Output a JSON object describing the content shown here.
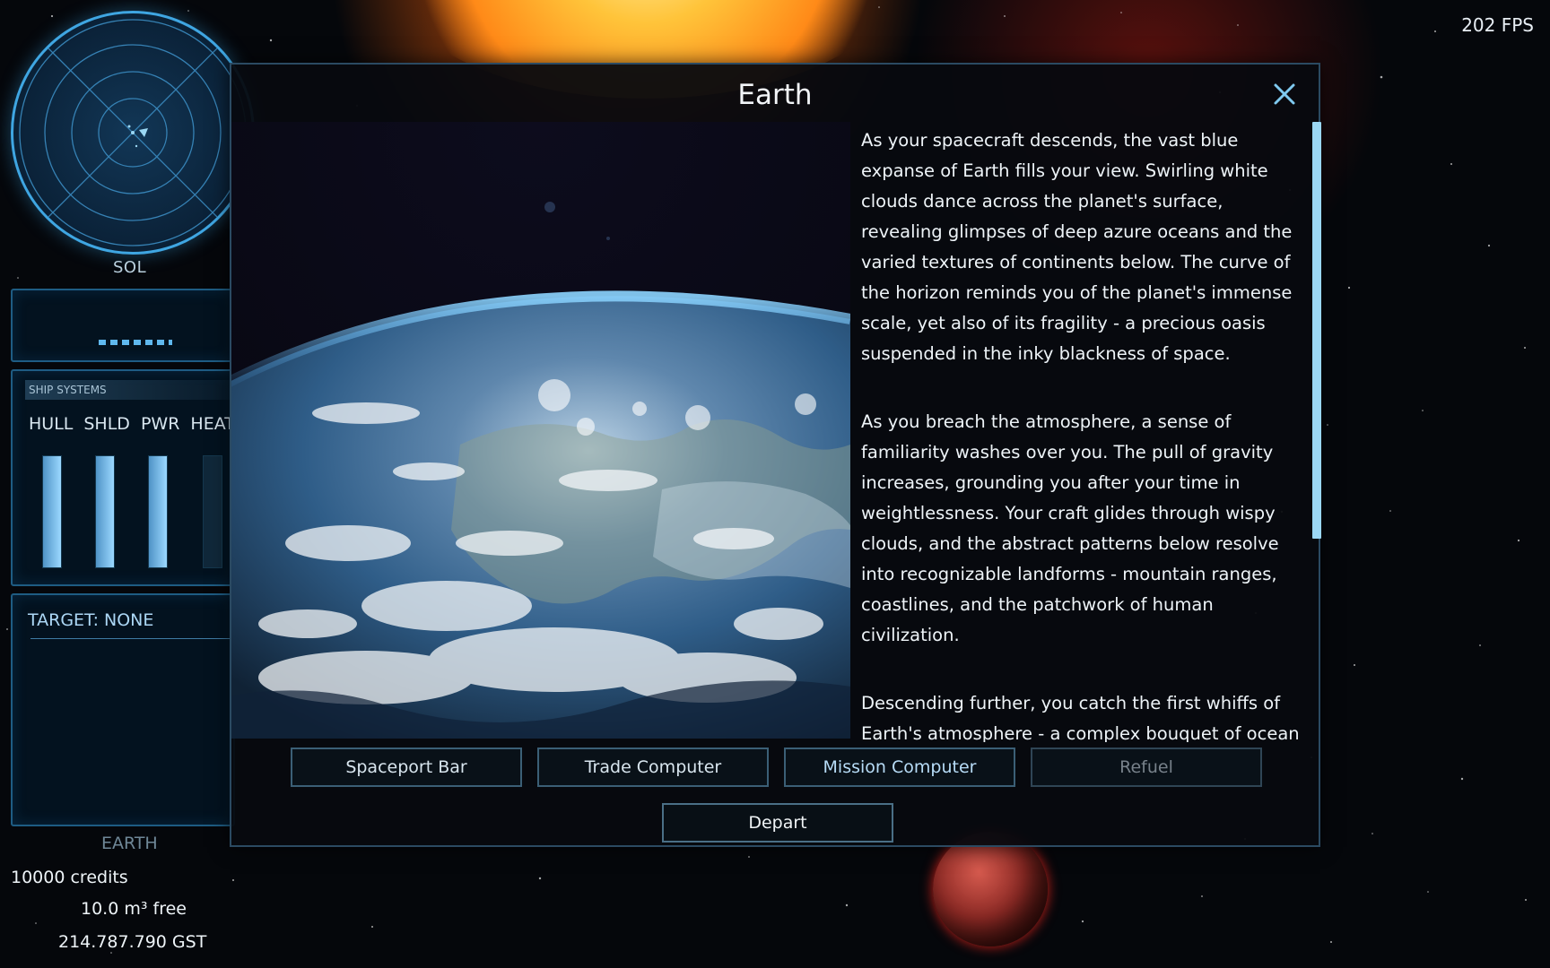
{
  "hud": {
    "fps": "202 FPS",
    "system_name": "SOL",
    "systems_panel": {
      "title": "SHIP SYSTEMS",
      "labels": [
        "HULL",
        "SHLD",
        "PWR",
        "HEAT"
      ],
      "levels": [
        1.0,
        1.0,
        1.0,
        0.0
      ]
    },
    "target_label": "TARGET: NONE",
    "location": "EARTH",
    "credits": "10000 credits",
    "cargo_free": "10.0 m³ free",
    "date": "214.787.790 GST"
  },
  "dialog": {
    "title": "Earth",
    "close_icon": "close-icon",
    "description": [
      "As your spacecraft descends, the vast blue expanse of Earth fills your view. Swirling white clouds dance across the planet's surface, revealing glimpses of deep azure oceans and the varied textures of continents below. The curve of the horizon reminds you of the planet's immense scale, yet also of its fragility - a precious oasis suspended in the inky blackness of space.",
      "As you breach the atmosphere, a sense of familiarity washes over you. The pull of gravity increases, grounding you after your time in weightlessness. Your craft glides through wispy clouds, and the abstract patterns below resolve into recognizable landforms - mountain ranges, coastlines, and the patchwork of human civilization.",
      "Descending further, you catch the first whiffs of Earth's atmosphere - a complex bouquet of ocean brine, verdant forests, and the indescribable scent of"
    ],
    "buttons": {
      "spaceport_bar": "Spaceport Bar",
      "trade_computer": "Trade Computer",
      "mission_computer": "Mission Computer",
      "refuel": "Refuel",
      "depart": "Depart"
    }
  },
  "colors": {
    "accent": "#3fa6e2",
    "scrollbar": "#9bd7f3",
    "panel_border": "#1e5c83"
  }
}
